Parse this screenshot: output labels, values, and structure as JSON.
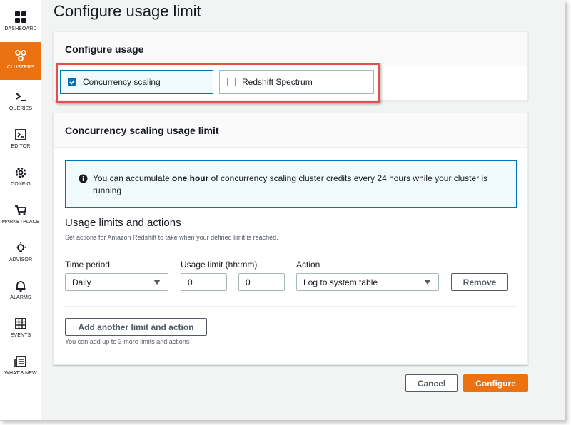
{
  "page": {
    "title": "Configure usage limit"
  },
  "sidebar": {
    "items": [
      {
        "label": "DASHBOARD",
        "icon": "dashboard-icon"
      },
      {
        "label": "CLUSTERS",
        "icon": "clusters-icon",
        "active": true
      },
      {
        "label": "QUERIES",
        "icon": "queries-icon"
      },
      {
        "label": "EDITOR",
        "icon": "editor-icon"
      },
      {
        "label": "CONFIG",
        "icon": "gear-icon"
      },
      {
        "label": "MARKETPLACE",
        "icon": "cart-icon"
      },
      {
        "label": "ADVISOR",
        "icon": "lightbulb-icon"
      },
      {
        "label": "ALARMS",
        "icon": "bell-icon"
      },
      {
        "label": "EVENTS",
        "icon": "calendar-icon"
      },
      {
        "label": "WHAT'S NEW",
        "icon": "newspaper-icon"
      }
    ]
  },
  "configure_usage": {
    "heading": "Configure usage",
    "options": [
      {
        "label": "Concurrency scaling",
        "checked": true
      },
      {
        "label": "Redshift Spectrum",
        "checked": false
      }
    ]
  },
  "limit_panel": {
    "heading": "Concurrency scaling usage limit",
    "info": {
      "text_before": "You can accumulate ",
      "text_bold": "one hour",
      "text_after": " of concurrency scaling cluster credits every 24 hours while your cluster is running"
    },
    "section_title": "Usage limits and actions",
    "section_desc": "Set actions for Amazon Redshift to take when your defined limit is reached.",
    "time_period_label": "Time period",
    "time_period_value": "Daily",
    "usage_limit_label": "Usage limit (hh:mm)",
    "hours_value": "0",
    "minutes_value": "0",
    "action_label": "Action",
    "action_value": "Log to system table",
    "remove_label": "Remove",
    "add_label": "Add another limit and action",
    "add_hint": "You can add up to 3 more limits and actions"
  },
  "footer": {
    "cancel_label": "Cancel",
    "configure_label": "Configure"
  },
  "colors": {
    "accent": "#ec7211",
    "info_blue": "#0073bb",
    "highlight_red": "#e0524c"
  }
}
